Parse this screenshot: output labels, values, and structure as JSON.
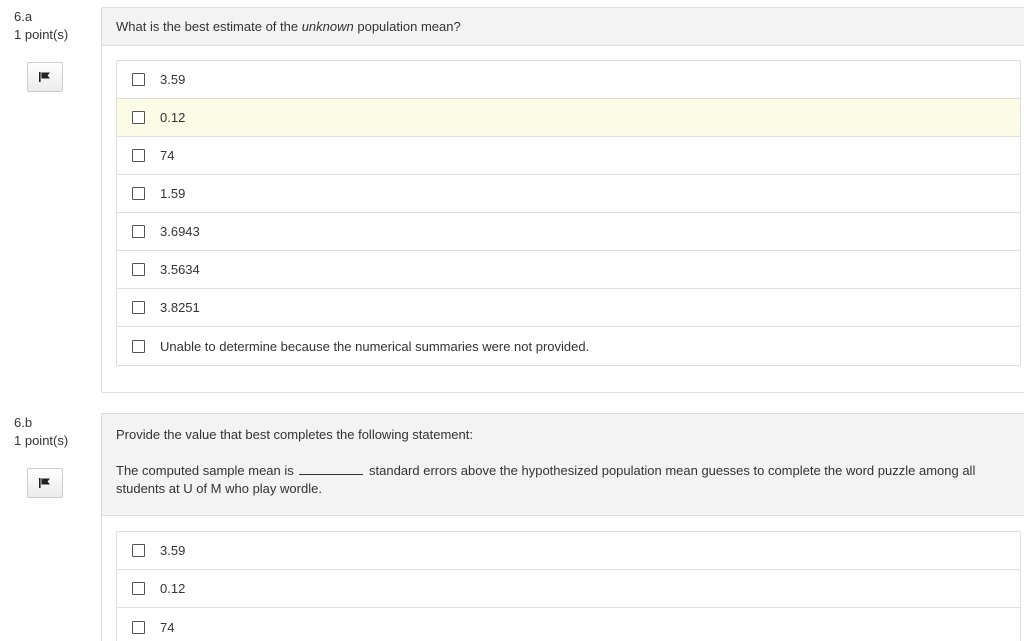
{
  "questions": [
    {
      "number": "6.a",
      "points": "1 point(s)",
      "prompt_before": "What is the best estimate of the ",
      "prompt_emphasis": "unknown",
      "prompt_after": " population mean?",
      "options": [
        "3.59",
        "0.12",
        "74",
        "1.59",
        "3.6943",
        "3.5634",
        "3.8251",
        "Unable to determine because the numerical summaries were not provided."
      ]
    },
    {
      "number": "6.b",
      "points": "1 point(s)",
      "prompt": "Provide the value that best completes the following statement:",
      "statement_before": "The computed sample mean is",
      "statement_after": "standard errors above the hypothesized population mean guesses to complete the word puzzle among all students at U of M who play wordle.",
      "options": [
        "3.59",
        "0.12",
        "74"
      ]
    }
  ],
  "colors": {
    "hover_row": "#fcfbe6",
    "header_bg": "#f3f3f3",
    "border": "#dddddd"
  },
  "icons": {
    "flag": "flag-icon",
    "checkbox": "checkbox-icon"
  }
}
